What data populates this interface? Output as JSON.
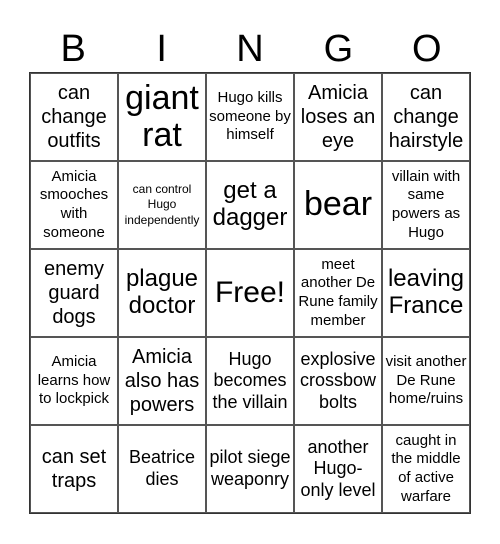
{
  "header": [
    "B",
    "I",
    "N",
    "G",
    "O"
  ],
  "cells": [
    {
      "text": "can change outfits",
      "size": "ml"
    },
    {
      "text": "giant rat",
      "size": "xl"
    },
    {
      "text": "Hugo kills someone by himself",
      "size": "s"
    },
    {
      "text": "Amicia loses an eye",
      "size": "ml"
    },
    {
      "text": "can change hairstyle",
      "size": "ml"
    },
    {
      "text": "Amicia smooches with someone",
      "size": "s"
    },
    {
      "text": "can control Hugo independently",
      "size": "xs"
    },
    {
      "text": "get a dagger",
      "size": "l"
    },
    {
      "text": "bear",
      "size": "xl"
    },
    {
      "text": "villain with same powers as Hugo",
      "size": "s"
    },
    {
      "text": "enemy guard dogs",
      "size": "ml"
    },
    {
      "text": "plague doctor",
      "size": "l"
    },
    {
      "text": "Free!",
      "size": "free"
    },
    {
      "text": "meet another De Rune family member",
      "size": "s"
    },
    {
      "text": "leaving France",
      "size": "l"
    },
    {
      "text": "Amicia learns how to lockpick",
      "size": "s"
    },
    {
      "text": "Amicia also has powers",
      "size": "ml"
    },
    {
      "text": "Hugo becomes the villain",
      "size": "m"
    },
    {
      "text": "explosive crossbow bolts",
      "size": "m"
    },
    {
      "text": "visit another De Rune home/ruins",
      "size": "s"
    },
    {
      "text": "can set traps",
      "size": "ml"
    },
    {
      "text": "Beatrice dies",
      "size": "m"
    },
    {
      "text": "pilot siege weaponry",
      "size": "m"
    },
    {
      "text": "another Hugo-only level",
      "size": "m"
    },
    {
      "text": "caught in the middle of active warfare",
      "size": "s"
    }
  ]
}
